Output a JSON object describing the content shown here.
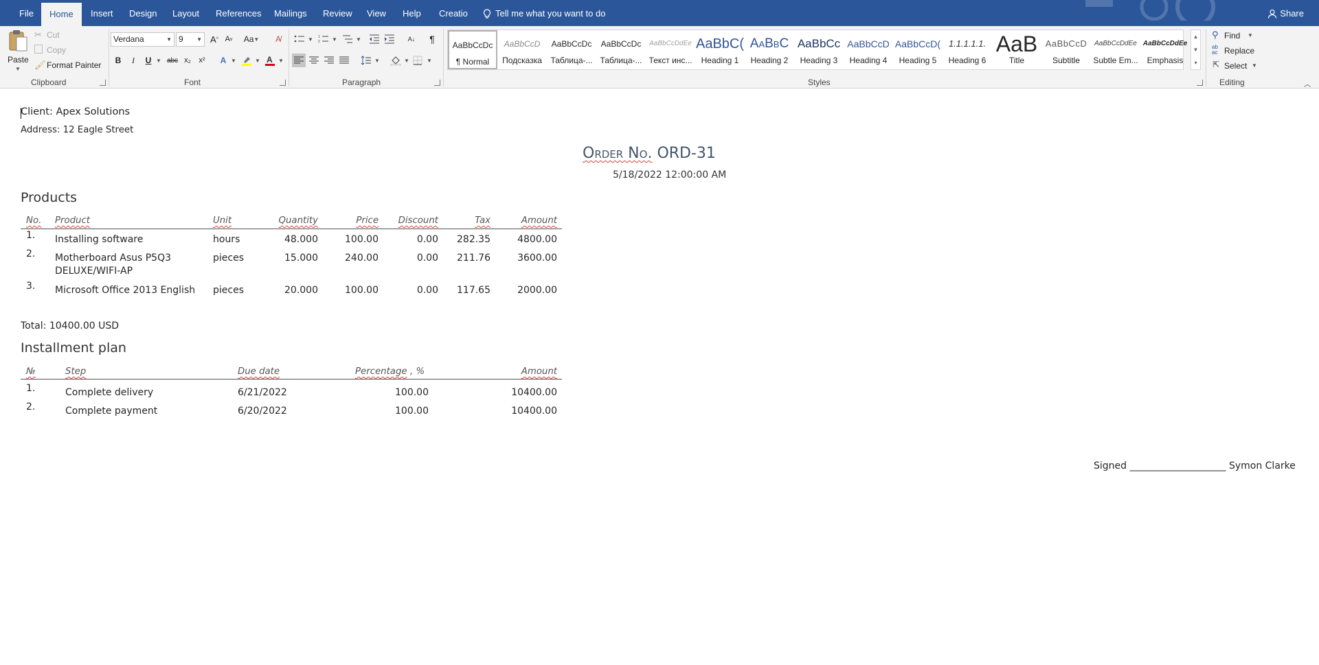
{
  "tabs": {
    "file": "File",
    "home": "Home",
    "insert": "Insert",
    "design": "Design",
    "layout": "Layout",
    "references": "References",
    "mailings": "Mailings",
    "review": "Review",
    "view": "View",
    "help": "Help",
    "creatio": "Creatio",
    "tell_me": "Tell me what you want to do",
    "share": "Share"
  },
  "clipboard": {
    "paste": "Paste",
    "cut": "Cut",
    "copy": "Copy",
    "format_painter": "Format Painter",
    "group": "Clipboard"
  },
  "font": {
    "name": "Verdana",
    "size": "9",
    "bold": "B",
    "italic": "I",
    "underline": "U",
    "strike": "abc",
    "sub": "x₂",
    "sup": "x²",
    "change_case": "Aa",
    "group": "Font"
  },
  "paragraph": {
    "group": "Paragraph",
    "pilcrow": "¶"
  },
  "styles": {
    "group": "Styles",
    "items": [
      {
        "preview": "AaBbCcDc",
        "label": "¶ Normal"
      },
      {
        "preview": "AaBbCcD",
        "label": "Подсказка"
      },
      {
        "preview": "AaBbCcDc",
        "label": "Таблица-..."
      },
      {
        "preview": "AaBbCcDc",
        "label": "Таблица-..."
      },
      {
        "preview": "AaBbCcDdEe",
        "label": "Текст инс..."
      },
      {
        "preview": "AaBbC(",
        "label": "Heading 1"
      },
      {
        "preview": "AaBbC",
        "label": "Heading 2"
      },
      {
        "preview": "AaBbCc",
        "label": "Heading 3"
      },
      {
        "preview": "AaBbCcD",
        "label": "Heading 4"
      },
      {
        "preview": "AaBbCcD(",
        "label": "Heading 5"
      },
      {
        "preview": "1.1.1.1.1.",
        "label": "Heading 6"
      },
      {
        "preview": "AaB",
        "label": "Title"
      },
      {
        "preview": "AaBbCcD",
        "label": "Subtitle"
      },
      {
        "preview": "AaBbCcDdEe",
        "label": "Subtle Em..."
      },
      {
        "preview": "AaBbCcDdEe",
        "label": "Emphasis"
      }
    ]
  },
  "editing": {
    "find": "Find",
    "replace": "Replace",
    "select": "Select",
    "group": "Editing"
  },
  "document": {
    "client": "Client: Apex Solutions",
    "address": "Address: 12 Eagle Street",
    "order_prefix": "Order No.",
    "order_number": "ORD-31",
    "order_date": "5/18/2022 12:00:00 AM",
    "products_heading": "Products",
    "products_headers": [
      "No.",
      "Product",
      "Unit",
      "Quantity",
      "Price",
      "Discount",
      "Tax",
      "Amount"
    ],
    "products": [
      {
        "no": "1.",
        "product": "Installing software",
        "product2": "",
        "unit": "hours",
        "quantity": "48.000",
        "price": "100.00",
        "discount": "0.00",
        "tax": "282.35",
        "amount": "4800.00"
      },
      {
        "no": "2.",
        "product": "Motherboard Asus P5Q3",
        "product2": "DELUXE/WIFI-AP",
        "unit": "pieces",
        "quantity": "15.000",
        "price": "240.00",
        "discount": "0.00",
        "tax": "211.76",
        "amount": "3600.00"
      },
      {
        "no": "3.",
        "product": "Microsoft Office 2013 English",
        "product2": "",
        "unit": "pieces",
        "quantity": "20.000",
        "price": "100.00",
        "discount": "0.00",
        "tax": "117.65",
        "amount": "2000.00"
      }
    ],
    "total": "Total: 10400.00 USD",
    "installment_heading": "Installment plan",
    "installment_headers": [
      "№",
      "Step",
      "Due date",
      "Percentage",
      ", %",
      "Amount"
    ],
    "installments": [
      {
        "no": "1.",
        "step": "Complete delivery",
        "due": "6/21/2022",
        "percentage": "100.00",
        "amount": "10400.00"
      },
      {
        "no": "2.",
        "step": "Complete payment",
        "due": "6/20/2022",
        "percentage": "100.00",
        "amount": "10400.00"
      }
    ],
    "signed_label": "Signed",
    "signature_line": "____________________",
    "signer": "Symon Clarke"
  },
  "colors": {
    "ribbon_blue": "#2b579a",
    "heading_blue": "#44546a",
    "spell_red": "#e23b3b"
  }
}
